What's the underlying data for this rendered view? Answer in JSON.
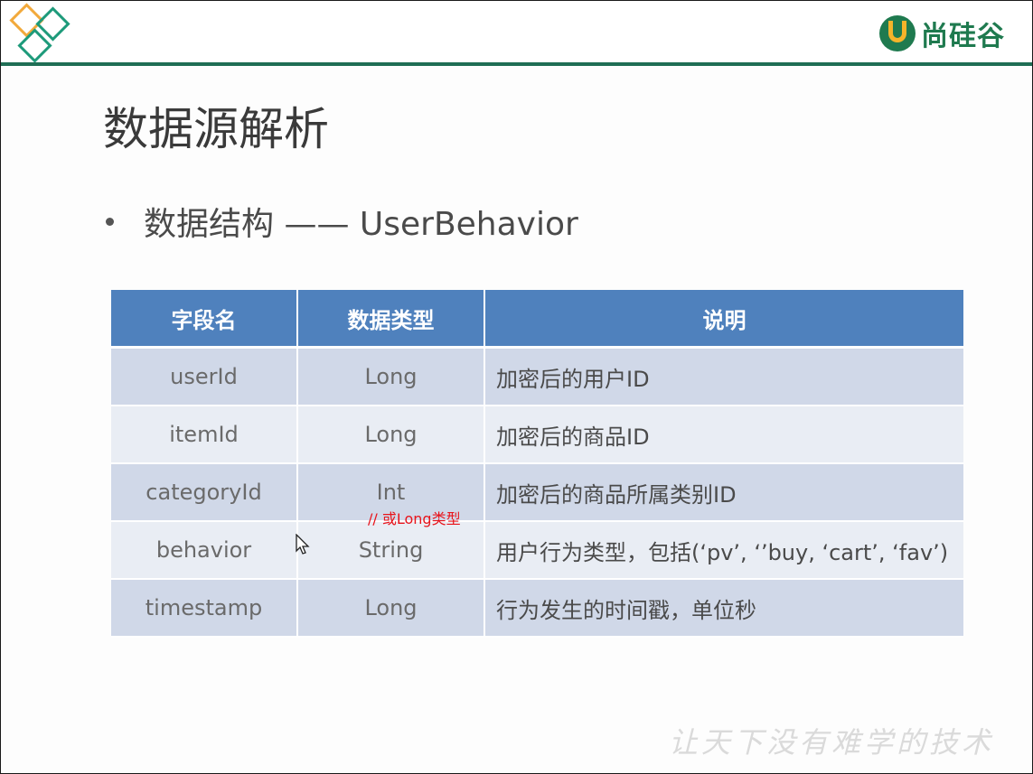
{
  "header": {
    "brand_name": "尚硅谷",
    "colors": {
      "accent_line": "#1f6e55",
      "logo_orange": "#f2a93b",
      "logo_teal": "#1d9a7a"
    }
  },
  "slide": {
    "title": "数据源解析",
    "bullet": "数据结构 —— UserBehavior",
    "table": {
      "headers": [
        "字段名",
        "数据类型",
        "说明"
      ],
      "rows": [
        {
          "name": "userId",
          "type": "Long",
          "desc": "加密后的用户ID"
        },
        {
          "name": "itemId",
          "type": "Long",
          "desc": "加密后的商品ID"
        },
        {
          "name": "categoryId",
          "type": "Int",
          "desc": "加密后的商品所属类别ID"
        },
        {
          "name": "behavior",
          "type": "String",
          "desc": "用户行为类型，包括(‘pv’, ‘’buy, ‘cart’, ‘fav’)"
        },
        {
          "name": "timestamp",
          "type": "Long",
          "desc": "行为发生的时间戳，单位秒"
        }
      ],
      "header_color": "#4f81bd"
    },
    "annotation": "// 或Long类型",
    "slogan": "让天下没有难学的技术"
  }
}
